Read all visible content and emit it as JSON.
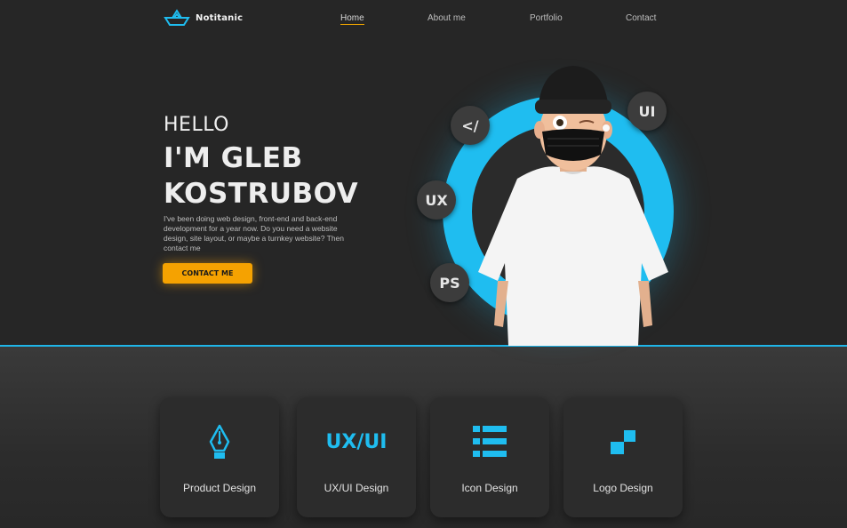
{
  "brand": {
    "name": "Notitanic",
    "accent": "#1fbdf0",
    "cta_color": "#f5a201"
  },
  "nav": {
    "items": [
      "Home",
      "About me",
      "Portfolio",
      "Contact"
    ],
    "active": "Home"
  },
  "hero": {
    "greeting": "HELLO",
    "name_line1": "I'M GLEB",
    "name_line2": "KOSTRUBOV",
    "description": "I've been doing web design, front-end and back-end development for a year now. Do you need a website design, site layout, or maybe a turnkey website? Then contact me",
    "cta": "CONTACT ME",
    "badges": [
      "</",
      "UI",
      "UX",
      "PS"
    ]
  },
  "services": [
    {
      "label": "Product Design",
      "icon": "pen-nib-icon"
    },
    {
      "label": "UX/UI Design",
      "icon": "ux-ui-text-icon",
      "icon_text": "UX/UI"
    },
    {
      "label": "Icon Design",
      "icon": "list-icon"
    },
    {
      "label": "Logo Design",
      "icon": "logo-squares-icon"
    }
  ]
}
